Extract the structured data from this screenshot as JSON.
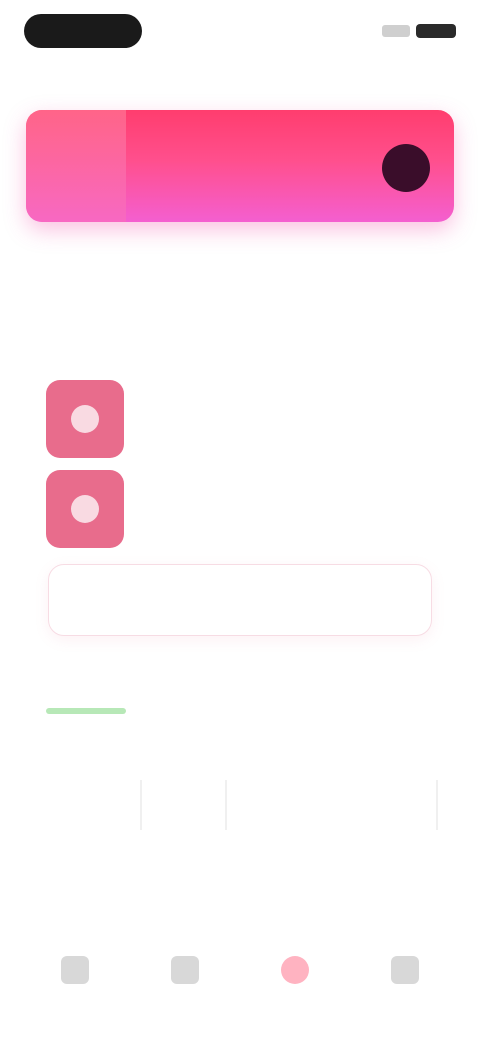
{
  "status": {
    "time_pill_color": "#1a1a1a"
  },
  "greeting": "",
  "banner": {
    "title": "",
    "subtitle": "",
    "colors": [
      "#ff3d6e",
      "#f45fd0"
    ]
  },
  "section": {
    "label": ""
  },
  "actions": [
    "",
    "",
    ""
  ],
  "playlist": [
    {
      "title": "",
      "subtitle": "",
      "icon": "play-icon"
    },
    {
      "title": "",
      "subtitle": "",
      "icon": "play-icon"
    }
  ],
  "cta": {
    "label": ""
  },
  "stats": [
    {
      "label": "",
      "value": "",
      "progress": 0.5
    },
    {
      "label": "",
      "value": ""
    }
  ],
  "links": [
    "",
    ""
  ],
  "tabs": [
    {
      "label": "",
      "icon": "home-icon",
      "active": false
    },
    {
      "label": "",
      "icon": "search-icon",
      "active": false
    },
    {
      "label": "",
      "icon": "heart-icon",
      "active": true
    },
    {
      "label": "",
      "icon": "profile-icon",
      "active": false
    }
  ],
  "accent": "#f1587a"
}
